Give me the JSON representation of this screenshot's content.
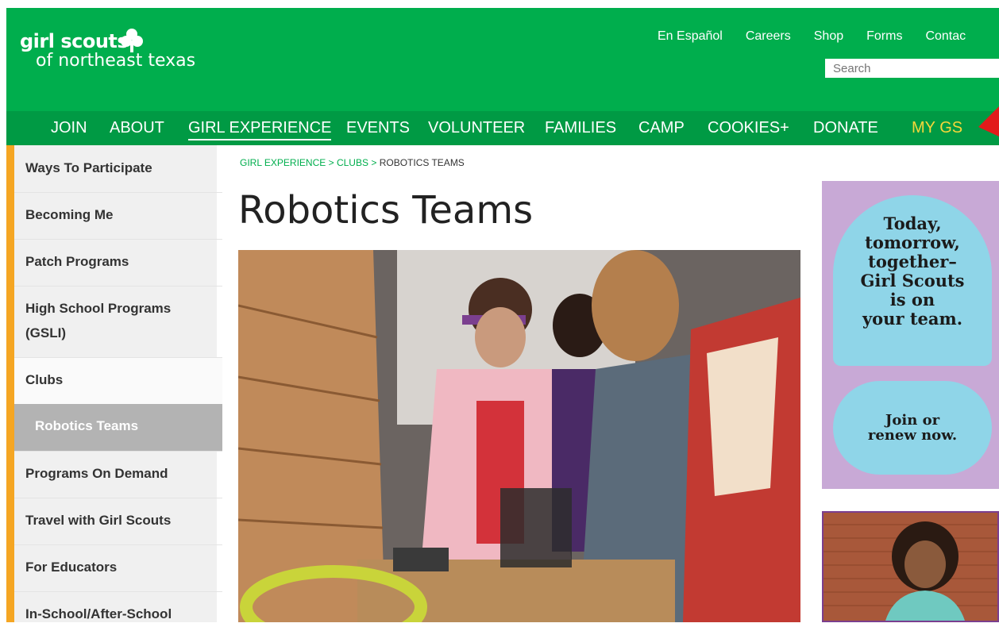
{
  "logo": {
    "line1": "girl scouts",
    "line2": "of northeast texas"
  },
  "utility_nav": [
    "En Español",
    "Careers",
    "Shop",
    "Forms",
    "Contac"
  ],
  "search": {
    "placeholder": "Search"
  },
  "main_nav": {
    "items": [
      "JOIN",
      "ABOUT",
      "GIRL EXPERIENCE",
      "EVENTS",
      "VOLUNTEER",
      "FAMILIES",
      "CAMP",
      "COOKIES+",
      "DONATE",
      "MY GS"
    ],
    "active": "GIRL EXPERIENCE"
  },
  "sidebar": {
    "items": [
      "Ways To Participate",
      "Becoming Me",
      "Patch Programs",
      "High School Programs",
      "(GSLI)",
      "Clubs",
      "Robotics Teams",
      "Programs On Demand",
      "Travel with Girl Scouts",
      "For Educators",
      "In-School/After-School"
    ],
    "selected": "Robotics Teams"
  },
  "breadcrumb": {
    "part1": "GIRL EXPERIENCE",
    "sep": ">",
    "part2": "CLUBS",
    "part3": "ROBOTICS TEAMS"
  },
  "page": {
    "title": "Robotics Teams"
  },
  "ad": {
    "lines": [
      "Today,",
      "tomorrow,",
      "together–",
      "Girl Scouts",
      "is on",
      "your team."
    ],
    "cta_lines": [
      "Join or",
      "renew now."
    ]
  },
  "colors": {
    "brand_green": "#00ae4d",
    "nav_green": "#009a44",
    "mygs_yellow": "#f6d73a",
    "sidebar_accent": "#f5a623",
    "ad_purple": "#c8a9d6",
    "ad_blue": "#8fd5e8"
  }
}
